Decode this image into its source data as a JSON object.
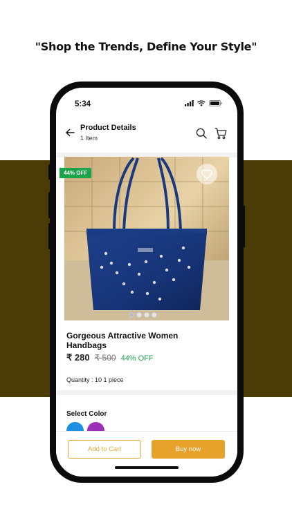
{
  "tagline": "\"Shop the Trends, Define Your Style\"",
  "colors": {
    "band": "#4a3b07",
    "accent": "#e6a22b",
    "discount_green": "#1ba34a"
  },
  "status_bar": {
    "time": "5:34"
  },
  "header": {
    "title": "Product Details",
    "subtitle": "1 Item",
    "icons": [
      "back-arrow-icon",
      "search-icon",
      "cart-icon"
    ]
  },
  "product": {
    "discount_badge": "44% OFF",
    "name": "Gorgeous Attractive Women Handbags",
    "price": "₹ 280",
    "mrp": "₹ 500",
    "discount": "44% OFF",
    "quantity": "Quantity : 10 1 piece",
    "image_count": 4,
    "active_image": 1
  },
  "colors_section": {
    "title": "Select Color",
    "swatches": [
      "#1d8fe0",
      "#9b2fb8"
    ]
  },
  "actions": {
    "add_to_cart": "Add to Cart",
    "buy_now": "Buy now"
  }
}
